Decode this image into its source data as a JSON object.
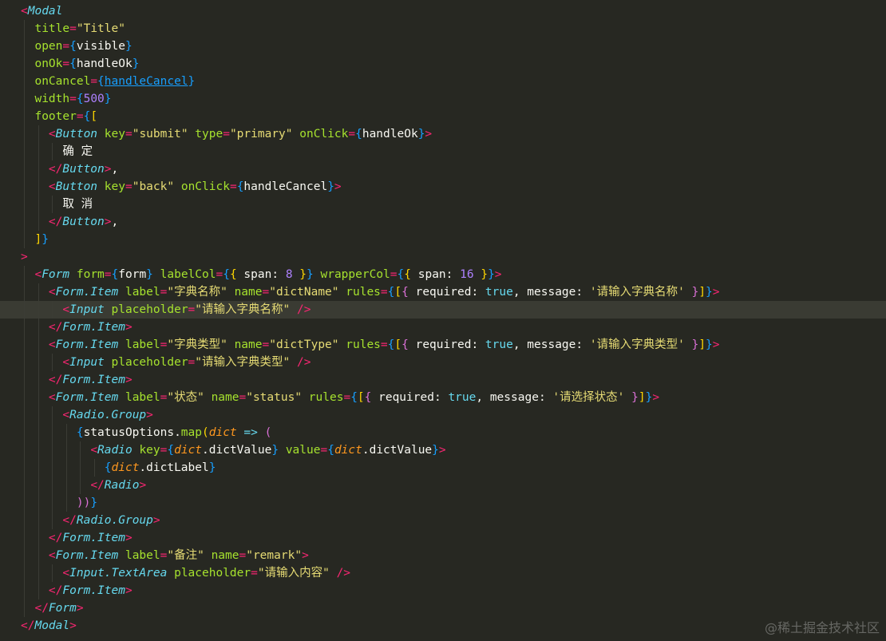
{
  "editor": {
    "theme_background": "#272822",
    "current_line": 17,
    "lines": [
      [
        [
          "<",
          "tag"
        ],
        [
          "Modal",
          "comp"
        ]
      ],
      [
        [
          "  ",
          ""
        ],
        [
          "title",
          "attr"
        ],
        [
          "=",
          "tag"
        ],
        [
          "\"Title\"",
          "str"
        ]
      ],
      [
        [
          "  ",
          ""
        ],
        [
          "open",
          "attr"
        ],
        [
          "=",
          "tag"
        ],
        [
          "{",
          "b3"
        ],
        [
          "visible",
          ""
        ],
        [
          "}",
          "b3"
        ]
      ],
      [
        [
          "  ",
          ""
        ],
        [
          "onOk",
          "attr"
        ],
        [
          "=",
          "tag"
        ],
        [
          "{",
          "b3"
        ],
        [
          "handleOk",
          ""
        ],
        [
          "}",
          "b3"
        ]
      ],
      [
        [
          "  ",
          ""
        ],
        [
          "onCancel",
          "attr"
        ],
        [
          "=",
          "tag"
        ],
        [
          "{",
          "b3"
        ],
        [
          "handleCancel",
          "b3 u"
        ],
        [
          "}",
          "b3"
        ]
      ],
      [
        [
          "  ",
          ""
        ],
        [
          "width",
          "attr"
        ],
        [
          "=",
          "tag"
        ],
        [
          "{",
          "b3"
        ],
        [
          "500",
          "num"
        ],
        [
          "}",
          "b3"
        ]
      ],
      [
        [
          "  ",
          ""
        ],
        [
          "footer",
          "attr"
        ],
        [
          "=",
          "tag"
        ],
        [
          "{",
          "b3"
        ],
        [
          "[",
          "b1"
        ]
      ],
      [
        [
          "    ",
          ""
        ],
        [
          "<",
          "tag"
        ],
        [
          "Button",
          "comp"
        ],
        [
          " ",
          ""
        ],
        [
          "key",
          "attr"
        ],
        [
          "=",
          "tag"
        ],
        [
          "\"submit\"",
          "str"
        ],
        [
          " ",
          ""
        ],
        [
          "type",
          "attr"
        ],
        [
          "=",
          "tag"
        ],
        [
          "\"primary\"",
          "str"
        ],
        [
          " ",
          ""
        ],
        [
          "onClick",
          "attr"
        ],
        [
          "=",
          "tag"
        ],
        [
          "{",
          "b3"
        ],
        [
          "handleOk",
          ""
        ],
        [
          "}",
          "b3"
        ],
        [
          ">",
          "tag"
        ]
      ],
      [
        [
          "      确 定",
          ""
        ]
      ],
      [
        [
          "    ",
          ""
        ],
        [
          "</",
          "tag"
        ],
        [
          "Button",
          "comp"
        ],
        [
          ">",
          "tag"
        ],
        [
          ",",
          ""
        ]
      ],
      [
        [
          "    ",
          ""
        ],
        [
          "<",
          "tag"
        ],
        [
          "Button",
          "comp"
        ],
        [
          " ",
          ""
        ],
        [
          "key",
          "attr"
        ],
        [
          "=",
          "tag"
        ],
        [
          "\"back\"",
          "str"
        ],
        [
          " ",
          ""
        ],
        [
          "onClick",
          "attr"
        ],
        [
          "=",
          "tag"
        ],
        [
          "{",
          "b3"
        ],
        [
          "handleCancel",
          ""
        ],
        [
          "}",
          "b3"
        ],
        [
          ">",
          "tag"
        ]
      ],
      [
        [
          "      取 消",
          ""
        ]
      ],
      [
        [
          "    ",
          ""
        ],
        [
          "</",
          "tag"
        ],
        [
          "Button",
          "comp"
        ],
        [
          ">",
          "tag"
        ],
        [
          ",",
          ""
        ]
      ],
      [
        [
          "  ",
          ""
        ],
        [
          "]",
          "b1"
        ],
        [
          "}",
          "b3"
        ]
      ],
      [
        [
          ">",
          "tag"
        ]
      ],
      [
        [
          "  ",
          ""
        ],
        [
          "<",
          "tag"
        ],
        [
          "Form",
          "comp"
        ],
        [
          " ",
          ""
        ],
        [
          "form",
          "attr"
        ],
        [
          "=",
          "tag"
        ],
        [
          "{",
          "b3"
        ],
        [
          "form",
          ""
        ],
        [
          "}",
          "b3"
        ],
        [
          " ",
          ""
        ],
        [
          "labelCol",
          "attr"
        ],
        [
          "=",
          "tag"
        ],
        [
          "{",
          "b3"
        ],
        [
          "{",
          "b1"
        ],
        [
          " span",
          ""
        ],
        [
          ":",
          ""
        ],
        [
          " ",
          ""
        ],
        [
          "8",
          "num"
        ],
        [
          " ",
          ""
        ],
        [
          "}",
          "b1"
        ],
        [
          "}",
          "b3"
        ],
        [
          " ",
          ""
        ],
        [
          "wrapperCol",
          "attr"
        ],
        [
          "=",
          "tag"
        ],
        [
          "{",
          "b3"
        ],
        [
          "{",
          "b1"
        ],
        [
          " span",
          ""
        ],
        [
          ":",
          ""
        ],
        [
          " ",
          ""
        ],
        [
          "16",
          "num"
        ],
        [
          " ",
          ""
        ],
        [
          "}",
          "b1"
        ],
        [
          "}",
          "b3"
        ],
        [
          ">",
          "tag"
        ]
      ],
      [
        [
          "    ",
          ""
        ],
        [
          "<",
          "tag"
        ],
        [
          "Form.Item",
          "comp"
        ],
        [
          " ",
          ""
        ],
        [
          "label",
          "attr"
        ],
        [
          "=",
          "tag"
        ],
        [
          "\"字典名称\"",
          "str"
        ],
        [
          " ",
          ""
        ],
        [
          "name",
          "attr"
        ],
        [
          "=",
          "tag"
        ],
        [
          "\"dictName\"",
          "str"
        ],
        [
          " ",
          ""
        ],
        [
          "rules",
          "attr"
        ],
        [
          "=",
          "tag"
        ],
        [
          "{",
          "b3"
        ],
        [
          "[",
          "b1"
        ],
        [
          "{",
          "b2"
        ],
        [
          " required",
          ""
        ],
        [
          ":",
          ""
        ],
        [
          " ",
          ""
        ],
        [
          "true",
          "kw"
        ],
        [
          ", message",
          ""
        ],
        [
          ":",
          ""
        ],
        [
          " ",
          ""
        ],
        [
          "'请输入字典名称'",
          "str"
        ],
        [
          " ",
          ""
        ],
        [
          "}",
          "b2"
        ],
        [
          "]",
          "b1"
        ],
        [
          "}",
          "b3"
        ],
        [
          ">",
          "tag"
        ]
      ],
      [
        [
          "      ",
          ""
        ],
        [
          "<",
          "tag"
        ],
        [
          "Input",
          "comp"
        ],
        [
          " ",
          ""
        ],
        [
          "placeholder",
          "attr"
        ],
        [
          "=",
          "tag"
        ],
        [
          "\"请输入字典名称\"",
          "str"
        ],
        [
          " ",
          ""
        ],
        [
          "/>",
          "tag"
        ]
      ],
      [
        [
          "    ",
          ""
        ],
        [
          "</",
          "tag"
        ],
        [
          "Form.Item",
          "comp"
        ],
        [
          ">",
          "tag"
        ]
      ],
      [
        [
          "    ",
          ""
        ],
        [
          "<",
          "tag"
        ],
        [
          "Form.Item",
          "comp"
        ],
        [
          " ",
          ""
        ],
        [
          "label",
          "attr"
        ],
        [
          "=",
          "tag"
        ],
        [
          "\"字典类型\"",
          "str"
        ],
        [
          " ",
          ""
        ],
        [
          "name",
          "attr"
        ],
        [
          "=",
          "tag"
        ],
        [
          "\"dictType\"",
          "str"
        ],
        [
          " ",
          ""
        ],
        [
          "rules",
          "attr"
        ],
        [
          "=",
          "tag"
        ],
        [
          "{",
          "b3"
        ],
        [
          "[",
          "b1"
        ],
        [
          "{",
          "b2"
        ],
        [
          " required",
          ""
        ],
        [
          ":",
          ""
        ],
        [
          " ",
          ""
        ],
        [
          "true",
          "kw"
        ],
        [
          ", message",
          ""
        ],
        [
          ":",
          ""
        ],
        [
          " ",
          ""
        ],
        [
          "'请输入字典类型'",
          "str"
        ],
        [
          " ",
          ""
        ],
        [
          "}",
          "b2"
        ],
        [
          "]",
          "b1"
        ],
        [
          "}",
          "b3"
        ],
        [
          ">",
          "tag"
        ]
      ],
      [
        [
          "      ",
          ""
        ],
        [
          "<",
          "tag"
        ],
        [
          "Input",
          "comp"
        ],
        [
          " ",
          ""
        ],
        [
          "placeholder",
          "attr"
        ],
        [
          "=",
          "tag"
        ],
        [
          "\"请输入字典类型\"",
          "str"
        ],
        [
          " ",
          ""
        ],
        [
          "/>",
          "tag"
        ]
      ],
      [
        [
          "    ",
          ""
        ],
        [
          "</",
          "tag"
        ],
        [
          "Form.Item",
          "comp"
        ],
        [
          ">",
          "tag"
        ]
      ],
      [
        [
          "    ",
          ""
        ],
        [
          "<",
          "tag"
        ],
        [
          "Form.Item",
          "comp"
        ],
        [
          " ",
          ""
        ],
        [
          "label",
          "attr"
        ],
        [
          "=",
          "tag"
        ],
        [
          "\"状态\"",
          "str"
        ],
        [
          " ",
          ""
        ],
        [
          "name",
          "attr"
        ],
        [
          "=",
          "tag"
        ],
        [
          "\"status\"",
          "str"
        ],
        [
          " ",
          ""
        ],
        [
          "rules",
          "attr"
        ],
        [
          "=",
          "tag"
        ],
        [
          "{",
          "b3"
        ],
        [
          "[",
          "b1"
        ],
        [
          "{",
          "b2"
        ],
        [
          " required",
          ""
        ],
        [
          ":",
          ""
        ],
        [
          " ",
          ""
        ],
        [
          "true",
          "kw"
        ],
        [
          ", message",
          ""
        ],
        [
          ":",
          ""
        ],
        [
          " ",
          ""
        ],
        [
          "'请选择状态'",
          "str"
        ],
        [
          " ",
          ""
        ],
        [
          "}",
          "b2"
        ],
        [
          "]",
          "b1"
        ],
        [
          "}",
          "b3"
        ],
        [
          ">",
          "tag"
        ]
      ],
      [
        [
          "      ",
          ""
        ],
        [
          "<",
          "tag"
        ],
        [
          "Radio.Group",
          "comp"
        ],
        [
          ">",
          "tag"
        ]
      ],
      [
        [
          "        ",
          ""
        ],
        [
          "{",
          "b3"
        ],
        [
          "statusOptions.",
          ""
        ],
        [
          "map",
          "fn"
        ],
        [
          "(",
          "b1"
        ],
        [
          "dict",
          "param"
        ],
        [
          " ",
          ""
        ],
        [
          "=>",
          "kw"
        ],
        [
          " ",
          ""
        ],
        [
          "(",
          "b2"
        ]
      ],
      [
        [
          "          ",
          ""
        ],
        [
          "<",
          "tag"
        ],
        [
          "Radio",
          "comp"
        ],
        [
          " ",
          ""
        ],
        [
          "key",
          "attr"
        ],
        [
          "=",
          "tag"
        ],
        [
          "{",
          "b3"
        ],
        [
          "dict",
          "param"
        ],
        [
          ".dictValue",
          ""
        ],
        [
          "}",
          "b3"
        ],
        [
          " ",
          ""
        ],
        [
          "value",
          "attr"
        ],
        [
          "=",
          "tag"
        ],
        [
          "{",
          "b3"
        ],
        [
          "dict",
          "param"
        ],
        [
          ".dictValue",
          ""
        ],
        [
          "}",
          "b3"
        ],
        [
          ">",
          "tag"
        ]
      ],
      [
        [
          "            ",
          ""
        ],
        [
          "{",
          "b3"
        ],
        [
          "dict",
          "param"
        ],
        [
          ".dictLabel",
          ""
        ],
        [
          "}",
          "b3"
        ]
      ],
      [
        [
          "          ",
          ""
        ],
        [
          "</",
          "tag"
        ],
        [
          "Radio",
          "comp"
        ],
        [
          ">",
          "tag"
        ]
      ],
      [
        [
          "        ",
          ""
        ],
        [
          "))",
          "b2"
        ],
        [
          "}",
          "b3"
        ]
      ],
      [
        [
          "      ",
          ""
        ],
        [
          "</",
          "tag"
        ],
        [
          "Radio.Group",
          "comp"
        ],
        [
          ">",
          "tag"
        ]
      ],
      [
        [
          "    ",
          ""
        ],
        [
          "</",
          "tag"
        ],
        [
          "Form.Item",
          "comp"
        ],
        [
          ">",
          "tag"
        ]
      ],
      [
        [
          "    ",
          ""
        ],
        [
          "<",
          "tag"
        ],
        [
          "Form.Item",
          "comp"
        ],
        [
          " ",
          ""
        ],
        [
          "label",
          "attr"
        ],
        [
          "=",
          "tag"
        ],
        [
          "\"备注\"",
          "str"
        ],
        [
          " ",
          ""
        ],
        [
          "name",
          "attr"
        ],
        [
          "=",
          "tag"
        ],
        [
          "\"remark\"",
          "str"
        ],
        [
          ">",
          "tag"
        ]
      ],
      [
        [
          "      ",
          ""
        ],
        [
          "<",
          "tag"
        ],
        [
          "Input",
          "comp"
        ],
        [
          ".TextArea",
          "comp"
        ],
        [
          " ",
          ""
        ],
        [
          "placeholder",
          "attr"
        ],
        [
          "=",
          "tag"
        ],
        [
          "\"请输入内容\"",
          "str"
        ],
        [
          " ",
          ""
        ],
        [
          "/>",
          "tag"
        ]
      ],
      [
        [
          "    ",
          ""
        ],
        [
          "</",
          "tag"
        ],
        [
          "Form.Item",
          "comp"
        ],
        [
          ">",
          "tag"
        ]
      ],
      [
        [
          "  ",
          ""
        ],
        [
          "</",
          "tag"
        ],
        [
          "Form",
          "comp"
        ],
        [
          ">",
          "tag"
        ]
      ],
      [
        [
          "</",
          "tag"
        ],
        [
          "Modal",
          "comp"
        ],
        [
          ">",
          "tag"
        ]
      ]
    ]
  },
  "watermark": "@稀土掘金技术社区"
}
